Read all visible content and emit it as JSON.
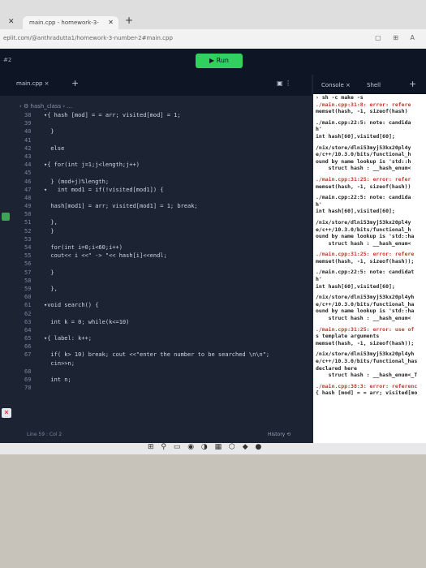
{
  "browser": {
    "tab_title": "main.cpp - homework-3-number",
    "url": "eplit.com/@anthradutta1/homework-3-number-2#main.cpp"
  },
  "replit": {
    "run_label": "▶ Run",
    "left_badge": "#2"
  },
  "editor": {
    "file_tab": "main.cpp ×",
    "breadcrumb": "› ⚙ hash_class › ...",
    "lines": [
      {
        "n": "38",
        "t": "▾{ hash [mod] = = arr; visited[mod] = 1;"
      },
      {
        "n": "39",
        "t": ""
      },
      {
        "n": "40",
        "t": "  }"
      },
      {
        "n": "41",
        "t": ""
      },
      {
        "n": "42",
        "t": "  else"
      },
      {
        "n": "43",
        "t": ""
      },
      {
        "n": "44",
        "t": "▾{ for(int j=1;j<length;j++)"
      },
      {
        "n": "45",
        "t": ""
      },
      {
        "n": "46",
        "t": "  } (mod+j)%length;"
      },
      {
        "n": "47",
        "t": "▾   int mod1 = if(!visited[mod1]) {"
      },
      {
        "n": "48",
        "t": ""
      },
      {
        "n": "49",
        "t": "  hash[mod1] = arr; visited[mod1] = 1; break;"
      },
      {
        "n": "50",
        "t": ""
      },
      {
        "n": "51",
        "t": "  },"
      },
      {
        "n": "52",
        "t": "  }"
      },
      {
        "n": "53",
        "t": ""
      },
      {
        "n": "54",
        "t": "  for(int i=0;i<60;i++)"
      },
      {
        "n": "55",
        "t": "  cout<< i <<\" -> \"<< hash[i]<<endl;"
      },
      {
        "n": "56",
        "t": ""
      },
      {
        "n": "57",
        "t": "  }"
      },
      {
        "n": "58",
        "t": ""
      },
      {
        "n": "59",
        "t": "  },"
      },
      {
        "n": "60",
        "t": ""
      },
      {
        "n": "61",
        "t": "▾void search() {"
      },
      {
        "n": "62",
        "t": ""
      },
      {
        "n": "63",
        "t": "  int k = 0; while(k<=10)"
      },
      {
        "n": "64",
        "t": ""
      },
      {
        "n": "65",
        "t": "▾{ label: k++;"
      },
      {
        "n": "66",
        "t": ""
      },
      {
        "n": "67",
        "t": "  if( k> 10) break; cout <<\"enter the number to be searched \\n\\n\";"
      },
      {
        "n": "",
        "t": "  cin>>n;"
      },
      {
        "n": "68",
        "t": ""
      },
      {
        "n": "69",
        "t": "  int n;"
      },
      {
        "n": "70",
        "t": ""
      }
    ],
    "status_left": "Line 59 : Col 2",
    "status_right": "History ⟲"
  },
  "console": {
    "tab_label": "Console ×",
    "shell_label": "Shell",
    "lines": [
      {
        "t": "› sh -c make -s",
        "c": ""
      },
      {
        "t": "./main.cpp:31:8: error: refere",
        "c": "err"
      },
      {
        "t": "memset(hash, -1, sizeof(hash)",
        "c": ""
      },
      {
        "t": "",
        "c": "gap"
      },
      {
        "t": "./main.cpp:22:5: note: candida",
        "c": ""
      },
      {
        "t": "h'",
        "c": ""
      },
      {
        "t": "int hash[60],visited[60];",
        "c": ""
      },
      {
        "t": "",
        "c": "gap"
      },
      {
        "t": "/nix/store/dlni53myj53kx20pl4y",
        "c": ""
      },
      {
        "t": "e/c++/10.3.0/bits/functional_h",
        "c": ""
      },
      {
        "t": "ound by name lookup is 'std::h",
        "c": ""
      },
      {
        "t": "    struct hash : __hash_enum<",
        "c": ""
      },
      {
        "t": "",
        "c": "gap"
      },
      {
        "t": "./main.cpp:31:25: error: refer",
        "c": "err"
      },
      {
        "t": "memset(hash, -1, sizeof(hash))",
        "c": ""
      },
      {
        "t": "",
        "c": "gap"
      },
      {
        "t": "./main.cpp:22:5: note: candida",
        "c": ""
      },
      {
        "t": "h'",
        "c": ""
      },
      {
        "t": "int hash[60],visited[60];",
        "c": ""
      },
      {
        "t": "",
        "c": "gap"
      },
      {
        "t": "/nix/store/dlni53myj53kx20pl4y",
        "c": ""
      },
      {
        "t": "e/c++/10.3.0/bits/functional_h",
        "c": ""
      },
      {
        "t": "ound by name lookup is 'std::ha",
        "c": ""
      },
      {
        "t": "    struct hash : __hash_enum<",
        "c": ""
      },
      {
        "t": "",
        "c": "gap"
      },
      {
        "t": "./main.cpp:31:25: error: refere",
        "c": "err"
      },
      {
        "t": "memset(hash, -1, sizeof(hash));",
        "c": ""
      },
      {
        "t": "",
        "c": "gap"
      },
      {
        "t": "./main.cpp:22:5: note: candidat",
        "c": ""
      },
      {
        "t": "h'",
        "c": ""
      },
      {
        "t": "int hash[60],visited[60];",
        "c": ""
      },
      {
        "t": "",
        "c": "gap"
      },
      {
        "t": "/nix/store/dlni53myj53kx20pl4yh",
        "c": ""
      },
      {
        "t": "e/c++/10.3.0/bits/functional_ha",
        "c": ""
      },
      {
        "t": "ound by name lookup is 'std::ha",
        "c": ""
      },
      {
        "t": "    struct hash : __hash_enum<",
        "c": ""
      },
      {
        "t": "",
        "c": "gap"
      },
      {
        "t": "./main.cpp:31:25: error: use of",
        "c": "err"
      },
      {
        "t": "s template arguments",
        "c": ""
      },
      {
        "t": "memset(hash, -1, sizeof(hash));",
        "c": ""
      },
      {
        "t": "",
        "c": "gap"
      },
      {
        "t": "/nix/store/dlni53myj53kx20pl4yh",
        "c": ""
      },
      {
        "t": "e/c++/10.3.0/bits/functional_has",
        "c": ""
      },
      {
        "t": "declared here",
        "c": ""
      },
      {
        "t": "    struct hash : __hash_enum<_T",
        "c": ""
      },
      {
        "t": "",
        "c": "gap"
      },
      {
        "t": "./main.cpp:38:3: error: referenc",
        "c": "err"
      },
      {
        "t": "{ hash [mod] = = arr; visited[mo",
        "c": ""
      }
    ]
  },
  "colors": {
    "run": "#32d05e",
    "editor_bg": "#1c2333",
    "error": "#c0392b"
  }
}
